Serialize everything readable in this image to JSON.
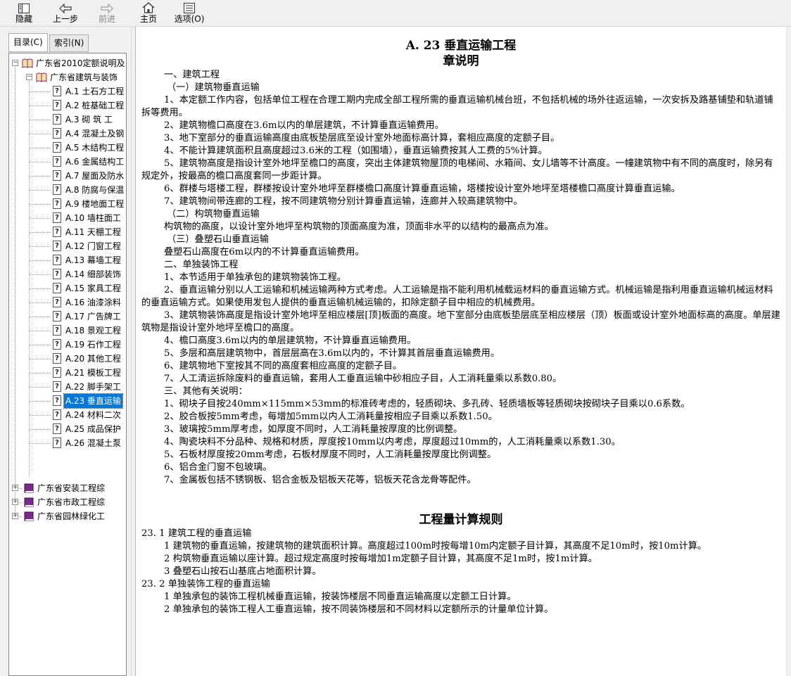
{
  "toolbar": {
    "hide": "隐藏",
    "back": "上一步",
    "forward": "前进",
    "home": "主页",
    "options": "选项(O)"
  },
  "tabs": {
    "contents": "目录(C)",
    "index": "索引(N)"
  },
  "tree": {
    "root": "广东省2010定额说明及",
    "book1": "广东省建筑与装饰",
    "items": [
      "A.1  土石方工程",
      "A.2  桩基础工程",
      "A.3  砌  筑  工",
      "A.4  混凝土及钢",
      "A.5  木结构工程",
      "A.6  金属结构工",
      "A.7 屋面及防水",
      "A.8  防腐与保温",
      "A.9  楼地面工程",
      "A.10  墙柱面工",
      "A.11  天棚工程",
      "A.12  门窗工程",
      "A.13  幕墙工程",
      "A.14  细部装饰",
      "A.15  家具工程",
      "A.16  油漆涂料",
      "A.17  广告牌工",
      "A.18  景观工程",
      "A.19  石作工程",
      "A.20  其他工程",
      "A.21  模板工程",
      "A.22  脚手架工",
      "A.23  垂直运输",
      "A.24  材料二次",
      "A.25  成品保护",
      "A.26  混凝土泵"
    ],
    "books": [
      "广东省安装工程综",
      "广东省市政工程综",
      "广东省园林绿化工"
    ]
  },
  "doc": {
    "title": "A. 23   垂直运输工程",
    "subtitle": "章说明",
    "s1": "一、建筑工程",
    "s1a": "（一）建筑物垂直运输",
    "p1": "1、本定额工作内容，包括单位工程在合理工期内完成全部工程所需的垂直运输机械台班，不包括机械的场外往返运输，一次安拆及路基铺垫和轨道铺拆等费用。",
    "p2": "2、建筑物檐口高度在3.6m以内的单层建筑，不计算垂直运输费用。",
    "p3": "3、地下室部分的垂直运输高度由底板垫层底至设计室外地面标高计算，套相应高度的定额子目。",
    "p4": "4、不能计算建筑面积且高度超过3.6米的工程（如围墙），垂直运输费按其人工费的5%计算。",
    "p5": "5、建筑物高度是指设计室外地坪至檐口的高度，突出主体建筑物屋顶的电梯间、水箱间、女儿墙等不计高度。一幢建筑物中有不同的高度时，除另有规定外，按最高的檐口高度套同一步距计算。",
    "p6": "6、群楼与塔楼工程，群楼按设计室外地坪至群楼檐口高度计算垂直运输，塔楼按设计室外地坪至塔楼檐口高度计算垂直运输。",
    "p7": "7、建筑物间带连廊的工程，按不同建筑物分别计算垂直运输，连廊并入较高建筑物中。",
    "s1b": "（二）构筑物垂直运输",
    "p8": "构筑物的高度，以设计室外地坪至构筑物的顶面高度为准，顶面非水平的以结构的最高点为准。",
    "s1c": "（三）叠塑石山垂直运输",
    "p9": "叠塑石山高度在6m以内的不计算垂直运输费用。",
    "s2": "二、单独装饰工程",
    "p10": "1、本节适用于单独承包的建筑物装饰工程。",
    "p11": "2、垂直运输分别以人工运输和机械运输两种方式考虑。人工运输是指不能利用机械载运材料的垂直运输方式。机械运输是指利用垂直运输机械运材料的垂直运输方式。如果使用发包人提供的垂直运输机械运输的，扣除定额子目中相应的机械费用。",
    "p12": "3、建筑物装饰高度是指设计室外地坪至相应楼层[顶]板面的高度。地下室部分由底板垫层底至相应楼层（顶）板面或设计室外地面标高的高度。单层建筑物是指设计室外地坪至檐口的高度。",
    "p13": "4、檐口高度3.6m以内的单层建筑物，不计算垂直运输费用。",
    "p14": "5、多层和高层建筑物中，首层层高在3.6m以内的，不计算其首层垂直运输费用。",
    "p15": "6、建筑物地下室按其不同的高度套相应高度的定额子目。",
    "p16": "7、人工清运拆除废料的垂直运输，套用人工垂直运输中砂相应子目，人工消耗量乘以系数0.80。",
    "s3": "三、其他有关说明：",
    "p17": "1、砌块子目按240mm×115mm×53mm的标准砖考虑的，轻质砌块、多孔砖、轻质墙板等轻质砌块按砌块子目乘以0.6系数。",
    "p18": "2、胶合板按5mm考虑，每增加5mm以内人工消耗量按相应子目乘以系数1.50。",
    "p19": "3、玻璃按5mm厚考虑，如厚度不同时，人工消耗量按厚度的比例调整。",
    "p20": "4、陶瓷块料不分品种、规格和材质，厚度按10mm以内考虑，厚度超过10mm的，人工消耗量乘以系数1.30。",
    "p21": "5、石板材厚度按20mm考虑，石板材厚度不同时，人工消耗量按厚度比例调整。",
    "p22": "6、铝合金门窗不包玻璃。",
    "p23": "7、金属板包括不锈钢板、铝合金板及铝板天花等，铝板天花含龙骨等配件。",
    "rules_title": "工程量计算规则",
    "r1": "23. 1  建筑工程的垂直运输",
    "r1a": "1  建筑物的垂直运输，按建筑物的建筑面积计算。高度超过100m时按每增10m内定额子目计算，其高度不足10m时，按10m计算。",
    "r1b": "2  构筑物垂直运输以座计算。超过规定高度时按每增加1m定额子目计算，其高度不足1m时，按1m计算。",
    "r1c": "3  叠塑石山按石山基底占地面积计算。",
    "r2": "23. 2  单独装饰工程的垂直运输",
    "r2a": "1  单独承包的装饰工程机械垂直运输，按装饰楼层不同垂直运输高度以定额工日计算。",
    "r2b": "2  单独承包的装饰工程人工垂直运输，按不同装饰楼层和不同材料以定额所示的计量单位计算。"
  }
}
